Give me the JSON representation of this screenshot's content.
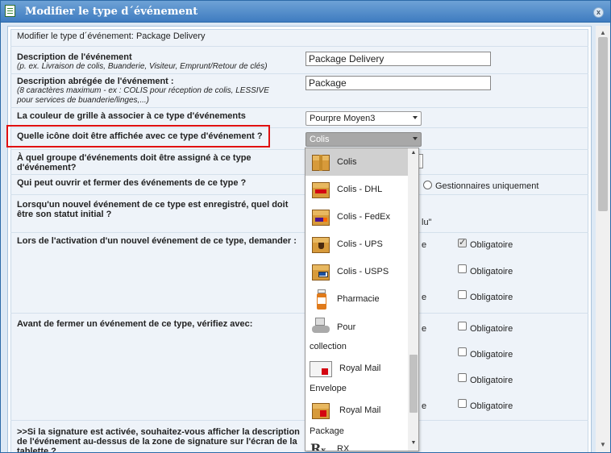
{
  "window": {
    "title": "Modifier le type d´événement",
    "close_label": "x"
  },
  "form": {
    "header": "Modifier le type d´événement: Package Delivery",
    "description": {
      "label": "Description de l'événement",
      "hint": "(p. ex. Livraison de colis, Buanderie, Visiteur, Emprunt/Retour de clés)",
      "value": "Package Delivery"
    },
    "short_description": {
      "label": "Description abrégée de l'événement :",
      "hint1": "(8 caractères maximum - ex : COLIS pour réception de colis, LESSIVE",
      "hint2": "pour services de buanderie/linges,...)",
      "value": "Package"
    },
    "grid_color": {
      "label": "La couleur de grille à associer à ce type d'événements",
      "value": "Pourpre Moyen3"
    },
    "icon": {
      "label": "Quelle icône doit être affichée avec ce type d'événement ?",
      "value": "Colis"
    },
    "group": {
      "label1": "À quel groupe d'événements doit être assigné à ce type",
      "label2": "d'événement?"
    },
    "open_close": {
      "label": "Qui peut ouvrir et fermer des événements de ce type ?",
      "radio_label": "Gestionnaires uniquement"
    },
    "initial_status": {
      "label1": "Lorsqu'un nouvel événement de ce type est enregistré, quel doit",
      "label2": "être son statut initial ?",
      "value_fragment": "lu\""
    },
    "on_activation": {
      "label": "Lors de l'activation d'un nouvel événement de ce type, demander :"
    },
    "before_close": {
      "label": "Avant de fermer un événement de ce type, vérifiez avec:"
    },
    "signature": {
      "label1": ">>Si la signature est activée, souhaitez-vous afficher la description",
      "label2": "de l'événement au-dessus de la zone de signature sur l'écran de la",
      "label3": "tablette ?"
    },
    "fragment_e": "e",
    "obligatoire": "Obligatoire"
  },
  "dropdown": {
    "options": [
      {
        "label": "Colis",
        "icon": "package-icon",
        "selected": true
      },
      {
        "label": "Colis - DHL",
        "icon": "package-dhl-icon"
      },
      {
        "label": "Colis - FedEx",
        "icon": "package-fedex-icon"
      },
      {
        "label": "Colis - UPS",
        "icon": "package-ups-icon"
      },
      {
        "label": "Colis - USPS",
        "icon": "package-usps-icon"
      },
      {
        "label": "Pharmacie",
        "icon": "pharmacy-bottle-icon"
      },
      {
        "label": "Pour",
        "label2": "collection",
        "icon": "pickup-hand-icon"
      },
      {
        "label": "Royal Mail",
        "label2": "Envelope",
        "icon": "royal-mail-envelope-icon"
      },
      {
        "label": "Royal Mail",
        "label2": "Package",
        "icon": "royal-mail-package-icon"
      },
      {
        "label": "RX",
        "icon": "rx-icon"
      }
    ]
  },
  "colors": {
    "titlebar": "#3f7cc0",
    "highlight_border": "#e01010"
  }
}
